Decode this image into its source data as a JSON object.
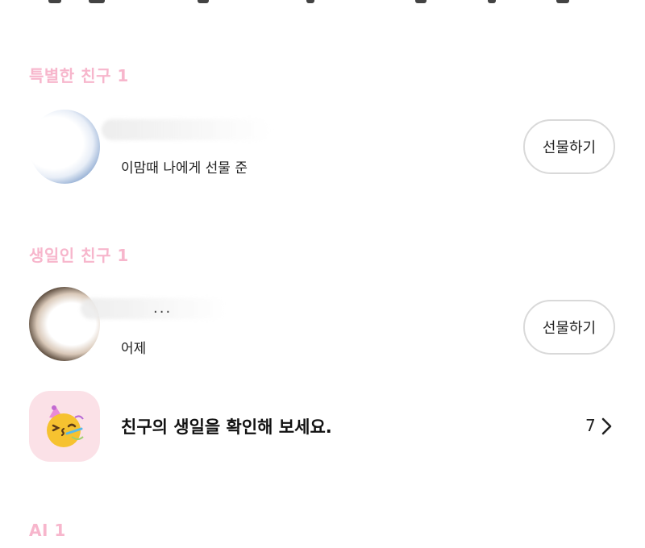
{
  "sections": {
    "special": {
      "title": "특별한 친구 1"
    },
    "birthday": {
      "title": "생일인 친구 1"
    },
    "ai": {
      "title": "AI 1"
    }
  },
  "special_friend": {
    "subtitle": "이맘때 나에게 선물 준",
    "button": "선물하기"
  },
  "birthday_friend": {
    "name_tail": "...",
    "subtitle": "어제",
    "button": "선물하기"
  },
  "birthday_check": {
    "text": "친구의 생일을 확인해 보세요.",
    "count": "7",
    "icon": "party-face-icon"
  },
  "colors": {
    "section_header": "#f7b6cc",
    "icon_bg": "#fbe1e7"
  }
}
